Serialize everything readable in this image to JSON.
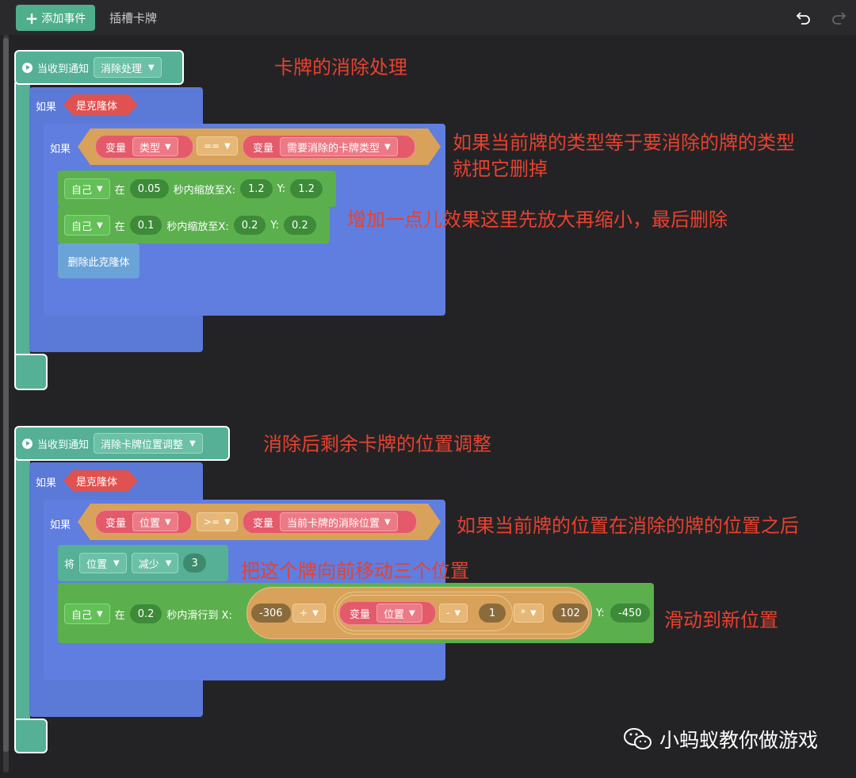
{
  "toolbar": {
    "add_event_label": "添加事件",
    "slot_tab_label": "插槽卡牌"
  },
  "colors": {
    "event": "#55b096",
    "control": "#5b79d6",
    "motion": "#5bb04d",
    "operator": "#d9a25a",
    "variable": "#e45a6a",
    "annotation": "#e8412f"
  },
  "script1": {
    "hat_label": "当收到通知",
    "message": "消除处理",
    "if_label": "如果",
    "is_clone": "是克隆体",
    "inner_if_label": "如果",
    "var_label": "变量",
    "var_left": "类型",
    "op": "==",
    "var_right": "需要消除的卡牌类型",
    "scale1": {
      "who": "自己",
      "at": "在",
      "secs": "0.05",
      "text": "秒内缩放至X:",
      "x": "1.2",
      "ylabel": "Y:",
      "y": "1.2"
    },
    "scale2": {
      "who": "自己",
      "at": "在",
      "secs": "0.1",
      "text": "秒内缩放至X:",
      "x": "0.2",
      "ylabel": "Y:",
      "y": "0.2"
    },
    "delete_label": "删除此克隆体"
  },
  "script2": {
    "hat_label": "当收到通知",
    "message": "消除卡牌位置调整",
    "if_label": "如果",
    "is_clone": "是克隆体",
    "inner_if_label": "如果",
    "var_label": "变量",
    "var_left": "位置",
    "op": ">=",
    "var_right": "当前卡牌的消除位置",
    "change": {
      "label": "将",
      "var": "位置",
      "mode": "减少",
      "value": "3"
    },
    "glide": {
      "who": "自己",
      "at": "在",
      "secs": "0.2",
      "text": "秒内滑行到 X:",
      "base": "-306",
      "plus": "+",
      "var_label": "变量",
      "var": "位置",
      "minus": "-",
      "one": "1",
      "times": "*",
      "mult": "102",
      "ylabel": "Y:",
      "y": "-450"
    }
  },
  "annotations": {
    "a1": "卡牌的消除处理",
    "a2": "如果当前牌的类型等于要消除的牌的类型",
    "a2b": "就把它删掉",
    "a3": "增加一点儿效果这里先放大再缩小，最后删除",
    "a4": "消除后剩余卡牌的位置调整",
    "a5": "如果当前牌的位置在消除的牌的位置之后",
    "a6": "把这个牌向前移动三个位置",
    "a7": "滑动到新位置"
  },
  "watermark": "小蚂蚁教你做游戏"
}
